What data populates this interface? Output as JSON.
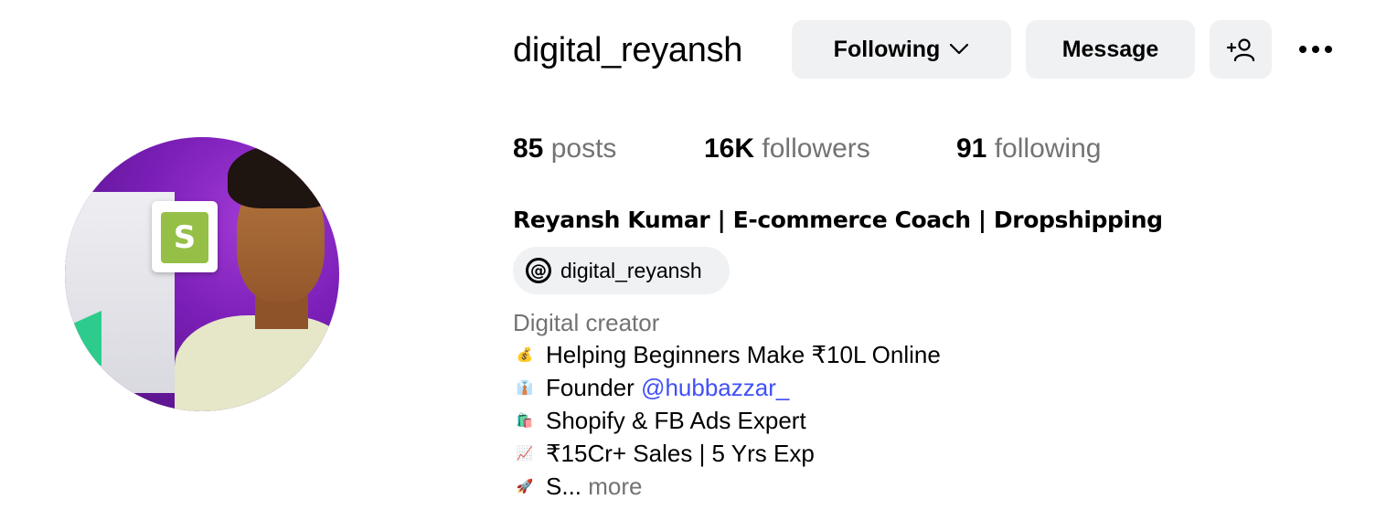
{
  "profile": {
    "username": "digital_reyansh",
    "full_name": "Reyansh Kumar | E-commerce Coach | Dropshipping",
    "category": "Digital creator",
    "threads_handle": "digital_reyansh"
  },
  "actions": {
    "following_label": "Following",
    "message_label": "Message"
  },
  "stats": {
    "posts_count": "85",
    "posts_label": "posts",
    "followers_count": "16K",
    "followers_label": "followers",
    "following_count": "91",
    "following_label": "following"
  },
  "bio": {
    "line1_emoji": "💰",
    "line1_text": "Helping Beginners Make ₹10L Online",
    "line2_emoji": "👔",
    "line2_text": "Founder ",
    "line2_mention": "@hubbazzar_",
    "line3_emoji": "🛍️",
    "line3_text": "Shopify & FB Ads Expert",
    "line4_emoji": "📈",
    "line4_text": "₹15Cr+ Sales | 5 Yrs Exp",
    "line5_emoji": "🚀",
    "line5_text": "S... ",
    "more_label": "more"
  },
  "icons": {
    "following_chevron": "chevron-down-icon",
    "add_user": "add-user-icon",
    "more_options": "more-horizontal-icon",
    "threads": "threads-icon"
  },
  "colors": {
    "button_bg": "#eff1f3",
    "mention": "#4150f7",
    "muted_text": "#737373"
  }
}
